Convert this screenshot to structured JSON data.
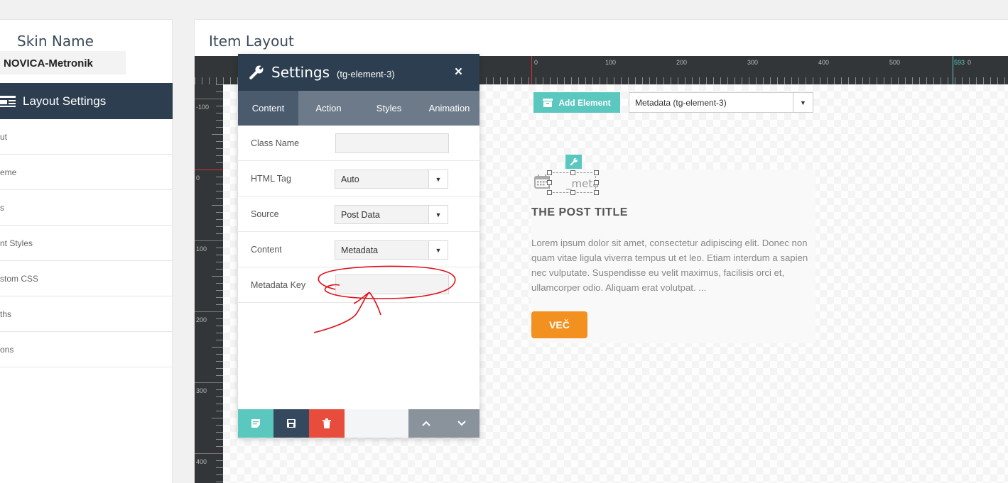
{
  "left_panel": {
    "skin_name_label": "Skin Name",
    "skin_name_value": "NOVICA-Metronik",
    "layout_settings_label": "Layout Settings",
    "items": [
      {
        "label": "ut"
      },
      {
        "label": "eme"
      },
      {
        "label": "s"
      },
      {
        "label": "nt Styles"
      },
      {
        "label": "stom CSS"
      },
      {
        "label": "ths"
      },
      {
        "label": "ons"
      }
    ]
  },
  "main": {
    "title": "Item Layout",
    "ruler_top_labels": [
      "0",
      "100",
      "200",
      "300",
      "400",
      "500",
      "593",
      "0"
    ],
    "ruler_left_labels": [
      "-100",
      "0",
      "100",
      "200",
      "300",
      "400"
    ],
    "add_element_label": "Add Element",
    "element_select_value": "Metadata (tg-element-3)",
    "card": {
      "meta_text": "_meta",
      "post_title": "THE POST TITLE",
      "excerpt": "Lorem ipsum dolor sit amet, consectetur adipiscing elit. Donec non quam vitae ligula viverra tempus ut et leo. Etiam interdum a sapien nec vulputate. Suspendisse eu velit maximus, facilisis orci et, ullamcorper odio. Aliquam erat volutpat. ...",
      "button_label": "VEČ"
    }
  },
  "settings": {
    "title": "Settings",
    "subtitle": "(tg-element-3)",
    "close_symbol": "×",
    "tabs": [
      {
        "label": "Content",
        "active": true
      },
      {
        "label": "Action",
        "active": false
      },
      {
        "label": "Styles",
        "active": false
      },
      {
        "label": "Animation",
        "active": false
      }
    ],
    "fields": {
      "class_name": {
        "label": "Class Name",
        "value": ""
      },
      "html_tag": {
        "label": "HTML Tag",
        "value": "Auto"
      },
      "source": {
        "label": "Source",
        "value": "Post Data"
      },
      "content": {
        "label": "Content",
        "value": "Metadata"
      },
      "metadata_key": {
        "label": "Metadata Key",
        "value": ""
      }
    }
  },
  "colors": {
    "dark_navy": "#2c3e50",
    "tab_bar": "#6c7a89",
    "teal": "#5bc8c0",
    "orange": "#f39120",
    "delete_red": "#e74c3c",
    "annotation_red": "#e0101a"
  }
}
